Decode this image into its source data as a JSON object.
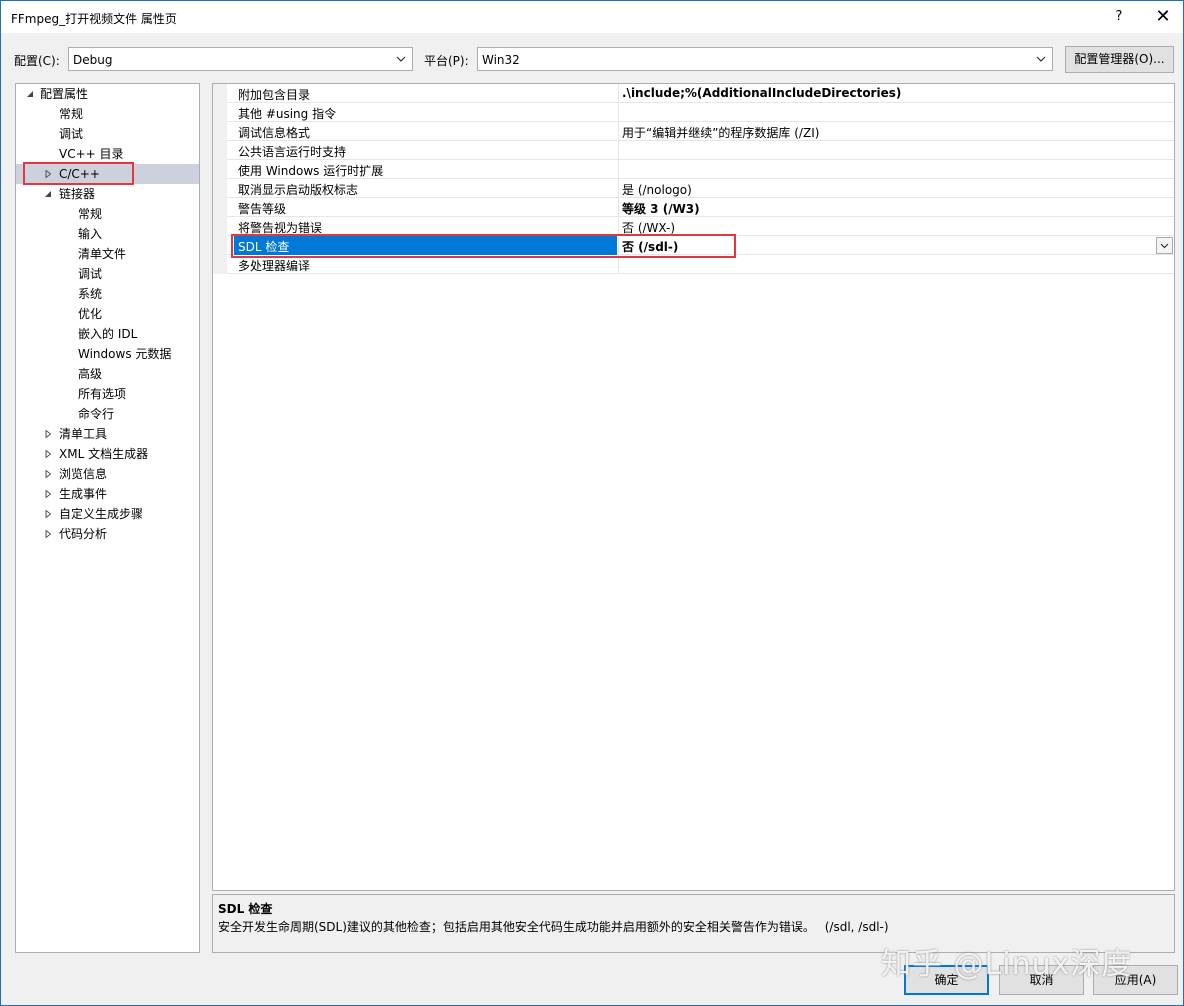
{
  "window": {
    "title": "FFmpeg_打开视频文件 属性页",
    "help": "?",
    "close": "✕"
  },
  "toolbar": {
    "config_label": "配置(C):",
    "config_value": "Debug",
    "platform_label": "平台(P):",
    "platform_value": "Win32",
    "config_manager_label": "配置管理器(O)..."
  },
  "tree": [
    {
      "label": "配置属性",
      "level": 0,
      "expander": "expanded"
    },
    {
      "label": "常规",
      "level": 1,
      "expander": "none"
    },
    {
      "label": "调试",
      "level": 1,
      "expander": "none"
    },
    {
      "label": "VC++ 目录",
      "level": 1,
      "expander": "none"
    },
    {
      "label": "C/C++",
      "level": 1,
      "expander": "collapsed",
      "selected": true
    },
    {
      "label": "链接器",
      "level": 1,
      "expander": "expanded"
    },
    {
      "label": "常规",
      "level": 2,
      "expander": "none"
    },
    {
      "label": "输入",
      "level": 2,
      "expander": "none"
    },
    {
      "label": "清单文件",
      "level": 2,
      "expander": "none"
    },
    {
      "label": "调试",
      "level": 2,
      "expander": "none"
    },
    {
      "label": "系统",
      "level": 2,
      "expander": "none"
    },
    {
      "label": "优化",
      "level": 2,
      "expander": "none"
    },
    {
      "label": "嵌入的 IDL",
      "level": 2,
      "expander": "none"
    },
    {
      "label": "Windows 元数据",
      "level": 2,
      "expander": "none"
    },
    {
      "label": "高级",
      "level": 2,
      "expander": "none"
    },
    {
      "label": "所有选项",
      "level": 2,
      "expander": "none"
    },
    {
      "label": "命令行",
      "level": 2,
      "expander": "none"
    },
    {
      "label": "清单工具",
      "level": 1,
      "expander": "collapsed"
    },
    {
      "label": "XML 文档生成器",
      "level": 1,
      "expander": "collapsed"
    },
    {
      "label": "浏览信息",
      "level": 1,
      "expander": "collapsed"
    },
    {
      "label": "生成事件",
      "level": 1,
      "expander": "collapsed"
    },
    {
      "label": "自定义生成步骤",
      "level": 1,
      "expander": "collapsed"
    },
    {
      "label": "代码分析",
      "level": 1,
      "expander": "collapsed"
    }
  ],
  "properties": [
    {
      "name": "附加包含目录",
      "value": ".\\include;%(AdditionalIncludeDirectories)",
      "bold": true
    },
    {
      "name": "其他 #using 指令",
      "value": "",
      "bold": false
    },
    {
      "name": "调试信息格式",
      "value": "用于“编辑并继续”的程序数据库 (/ZI)",
      "bold": false
    },
    {
      "name": "公共语言运行时支持",
      "value": "",
      "bold": false
    },
    {
      "name": "使用 Windows 运行时扩展",
      "value": "",
      "bold": false
    },
    {
      "name": "取消显示启动版权标志",
      "value": "是 (/nologo)",
      "bold": false
    },
    {
      "name": "警告等级",
      "value": "等级 3 (/W3)",
      "bold": true
    },
    {
      "name": "将警告视为错误",
      "value": "否 (/WX-)",
      "bold": false
    },
    {
      "name": "SDL 检查",
      "value": "否 (/sdl-)",
      "bold": true,
      "selected": true
    },
    {
      "name": "多处理器编译",
      "value": "",
      "bold": false
    }
  ],
  "description": {
    "title": "SDL 检查",
    "text": "安全开发生命周期(SDL)建议的其他检查；包括启用其他安全代码生成功能并启用额外的安全相关警告作为错误。　 (/sdl, /sdl-)"
  },
  "buttons": {
    "ok": "确定",
    "cancel": "取消",
    "apply": "应用(A)"
  },
  "watermark": "知乎 @Linux深度",
  "colors": {
    "selection": "#0078d7",
    "highlight_box": "#e0383e",
    "window_border": "#1e6fbf"
  }
}
